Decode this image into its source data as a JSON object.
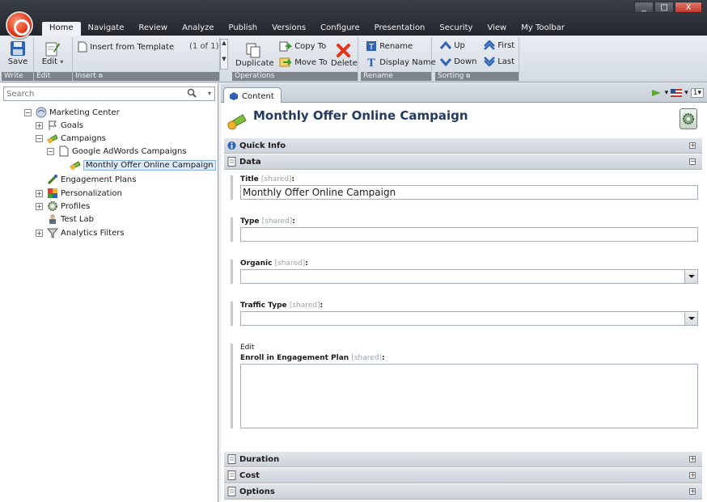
{
  "window": {
    "controls": {
      "minimize": "_",
      "maximize": "□",
      "close": "X"
    }
  },
  "tabs": [
    "Home",
    "Navigate",
    "Review",
    "Analyze",
    "Publish",
    "Versions",
    "Configure",
    "Presentation",
    "Security",
    "View",
    "My Toolbar"
  ],
  "ribbon": {
    "write": {
      "label": "Write",
      "save": "Save"
    },
    "edit": {
      "label": "Edit",
      "edit": "Edit"
    },
    "insert": {
      "label": "Insert",
      "template": "Insert from Template",
      "count": "(1 of 1)"
    },
    "operations": {
      "label": "Operations",
      "duplicate": "Duplicate",
      "copy_to": "Copy To",
      "move_to": "Move To",
      "delete": "Delete"
    },
    "rename": {
      "label": "Rename",
      "rename": "Rename",
      "display_name": "Display Name"
    },
    "sorting": {
      "label": "Sorting",
      "up": "Up",
      "down": "Down",
      "first": "First",
      "last": "Last"
    }
  },
  "search": {
    "placeholder": "Search"
  },
  "tree": {
    "root": "Marketing Center",
    "goals": "Goals",
    "campaigns": "Campaigns",
    "google": "Google AdWords Campaigns",
    "monthly": "Monthly Offer Online Campaign",
    "engagement": "Engagement Plans",
    "personalization": "Personalization",
    "profiles": "Profiles",
    "testlab": "Test Lab",
    "analytics": "Analytics Filters"
  },
  "content": {
    "tab": "Content",
    "lang_count": "1",
    "item_title": "Monthly Offer Online Campaign",
    "sections": {
      "quick_info": "Quick Info",
      "data": "Data",
      "duration": "Duration",
      "cost": "Cost",
      "options": "Options"
    },
    "fields": {
      "shared": "[shared]",
      "title_label": "Title",
      "title_value": "Monthly Offer Online Campaign",
      "type_label": "Type",
      "organic_label": "Organic",
      "traffic_label": "Traffic Type",
      "edit": "Edit",
      "enroll_label": "Enroll in Engagement Plan"
    }
  },
  "colors": {
    "ribbon_bg": "#d5dbe3",
    "title_blue": "#243a63",
    "tab_bar": "#2b3036"
  }
}
